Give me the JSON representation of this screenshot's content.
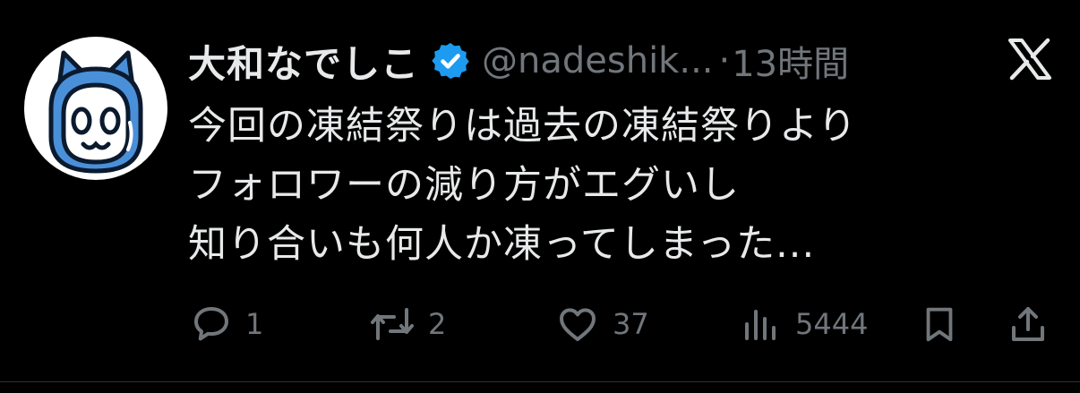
{
  "tweet": {
    "display_name": "大和なでしこ",
    "handle": "@nadeshik...",
    "separator": "·",
    "time": "13時間",
    "body_lines": [
      "今回の凍結祭りは過去の凍結祭りより",
      "フォロワーの減り方がエグいし",
      "知り合いも何人か凍ってしまった..."
    ],
    "actions": {
      "reply_count": "1",
      "repost_count": "2",
      "like_count": "37",
      "views_count": "5444"
    }
  },
  "icons": {
    "verified": "verified-badge-icon",
    "platform": "x-logo-icon",
    "reply": "speech-bubble-icon",
    "repost": "repost-arrows-icon",
    "like": "heart-icon",
    "views": "bar-chart-icon",
    "bookmark": "bookmark-icon",
    "share": "share-upload-icon"
  },
  "colors": {
    "background": "#000000",
    "primary_text": "#e7e9ea",
    "secondary_text": "#71767b",
    "verified_blue": "#1d9bf0",
    "avatar_blue": "#4a90d9"
  }
}
